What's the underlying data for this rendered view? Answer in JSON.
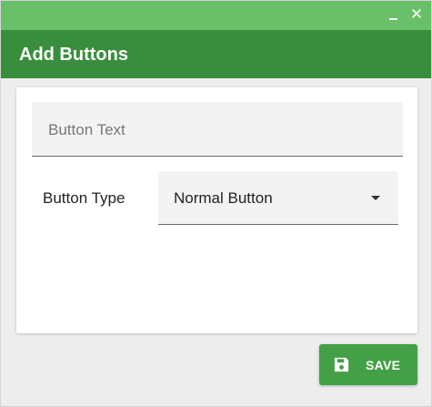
{
  "window": {
    "title": "Add Buttons",
    "minimize_glyph": "_",
    "close_glyph": "✕"
  },
  "form": {
    "button_text_placeholder": "Button Text",
    "button_text_value": "",
    "button_type_label": "Button Type",
    "button_type_selected": "Normal Button"
  },
  "footer": {
    "save_label": "SAVE",
    "save_icon": "floppy-disk-icon"
  },
  "colors": {
    "titlebar": "#6abf69",
    "header": "#388e3c",
    "save_button": "#43a047",
    "background": "#ededed"
  }
}
